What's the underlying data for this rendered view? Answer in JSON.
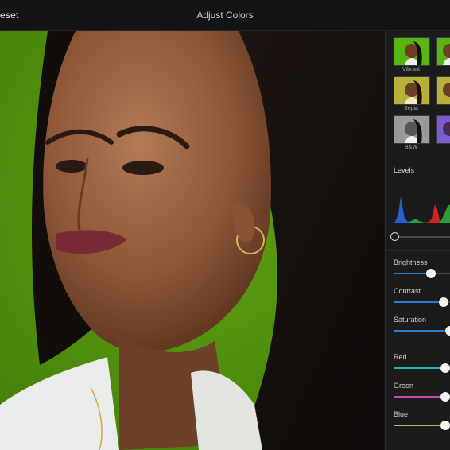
{
  "header": {
    "reset_label": "eset",
    "title": "Adjust Colors"
  },
  "filters": [
    {
      "label": "Vibrant",
      "style": "vibrant"
    },
    {
      "label": "",
      "style": "vibrant-alt"
    },
    {
      "label": "Sepia",
      "style": "sepia"
    },
    {
      "label": "B",
      "style": "sepia-alt"
    },
    {
      "label": "B&W",
      "style": "bw"
    },
    {
      "label": "",
      "style": "purple"
    }
  ],
  "levels": {
    "label": "Levels",
    "black_point": 0.0
  },
  "adjustments": [
    {
      "label": "Brightness",
      "value": 0.65,
      "color": "#2f7bdb"
    },
    {
      "label": "Contrast",
      "value": 0.87,
      "color": "#2f7bdb"
    },
    {
      "label": "Saturation",
      "value": 0.98,
      "color": "#2f7bdb"
    },
    {
      "label": "Red",
      "value": 0.9,
      "color": "#2bb3b3"
    },
    {
      "label": "Green",
      "value": 0.9,
      "color": "#c64ab0"
    },
    {
      "label": "Blue",
      "value": 0.9,
      "color": "#c9b247"
    }
  ],
  "colors": {
    "background": "#141414",
    "panel": "#1b1b1b",
    "wall": "#4f8f0d"
  }
}
